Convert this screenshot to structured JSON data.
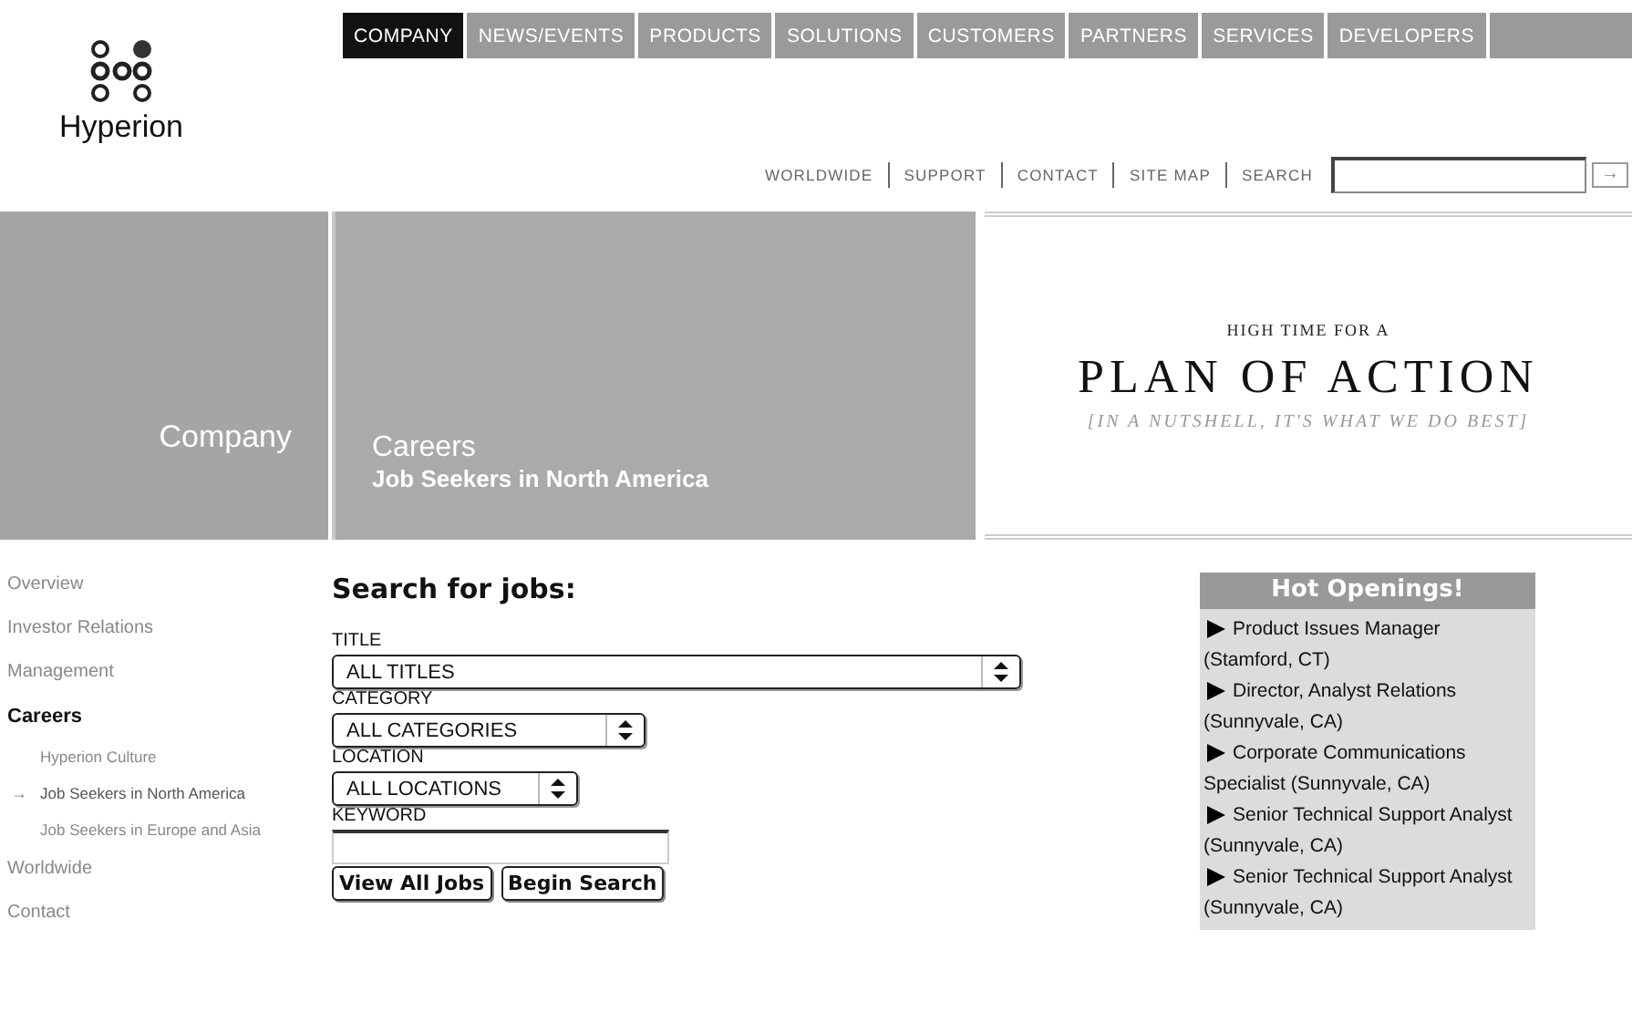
{
  "logo": {
    "name": "Hyperion"
  },
  "main_nav": [
    {
      "label": "COMPANY",
      "selected": true
    },
    {
      "label": "NEWS/EVENTS",
      "selected": false
    },
    {
      "label": "PRODUCTS",
      "selected": false
    },
    {
      "label": "SOLUTIONS",
      "selected": false
    },
    {
      "label": "CUSTOMERS",
      "selected": false
    },
    {
      "label": "PARTNERS",
      "selected": false
    },
    {
      "label": "SERVICES",
      "selected": false
    },
    {
      "label": "DEVELOPERS",
      "selected": false
    }
  ],
  "utility_links": [
    "WORLDWIDE",
    "SUPPORT",
    "CONTACT",
    "SITE MAP",
    "SEARCH"
  ],
  "search": {
    "button": "→"
  },
  "banner": {
    "section": "Company",
    "title": "Careers",
    "subtitle": "Job Seekers in North America",
    "kicker": "HIGH TIME FOR A",
    "headline": "PLAN OF ACTION",
    "tagline": "[IN A NUTSHELL, IT'S WHAT WE DO BEST]"
  },
  "sidebar": {
    "items": [
      {
        "label": "Overview",
        "selected": false
      },
      {
        "label": "Investor Relations",
        "selected": false
      },
      {
        "label": "Management",
        "selected": false
      },
      {
        "label": "Careers",
        "selected": true,
        "children": [
          {
            "label": "Hyperion Culture",
            "selected": false
          },
          {
            "label": "Job Seekers in North America",
            "selected": true,
            "marker": "→"
          },
          {
            "label": "Job Seekers in Europe and Asia",
            "selected": false
          }
        ]
      },
      {
        "label": "Worldwide",
        "selected": false
      },
      {
        "label": "Contact",
        "selected": false
      }
    ]
  },
  "job_search": {
    "heading": "Search for jobs:",
    "fields": [
      {
        "label": "TITLE",
        "kind": "select",
        "value": "ALL TITLES"
      },
      {
        "label": "CATEGORY",
        "kind": "select",
        "value": "ALL CATEGORIES"
      },
      {
        "label": "LOCATION",
        "kind": "select",
        "value": "ALL LOCATIONS"
      },
      {
        "label": "KEYWORD",
        "kind": "text"
      }
    ],
    "buttons": [
      "View All Jobs",
      "Begin Search"
    ]
  },
  "hot_openings": {
    "title": "Hot Openings!",
    "items": [
      "Product Issues Manager (Stamford, CT)",
      "Director, Analyst Relations (Sunnyvale, CA)",
      "Corporate Communications Specialist (Sunnyvale, CA)",
      "Senior Technical Support Analyst (Sunnyvale, CA)",
      "Senior Technical Support Analyst (Sunnyvale, CA)"
    ]
  }
}
